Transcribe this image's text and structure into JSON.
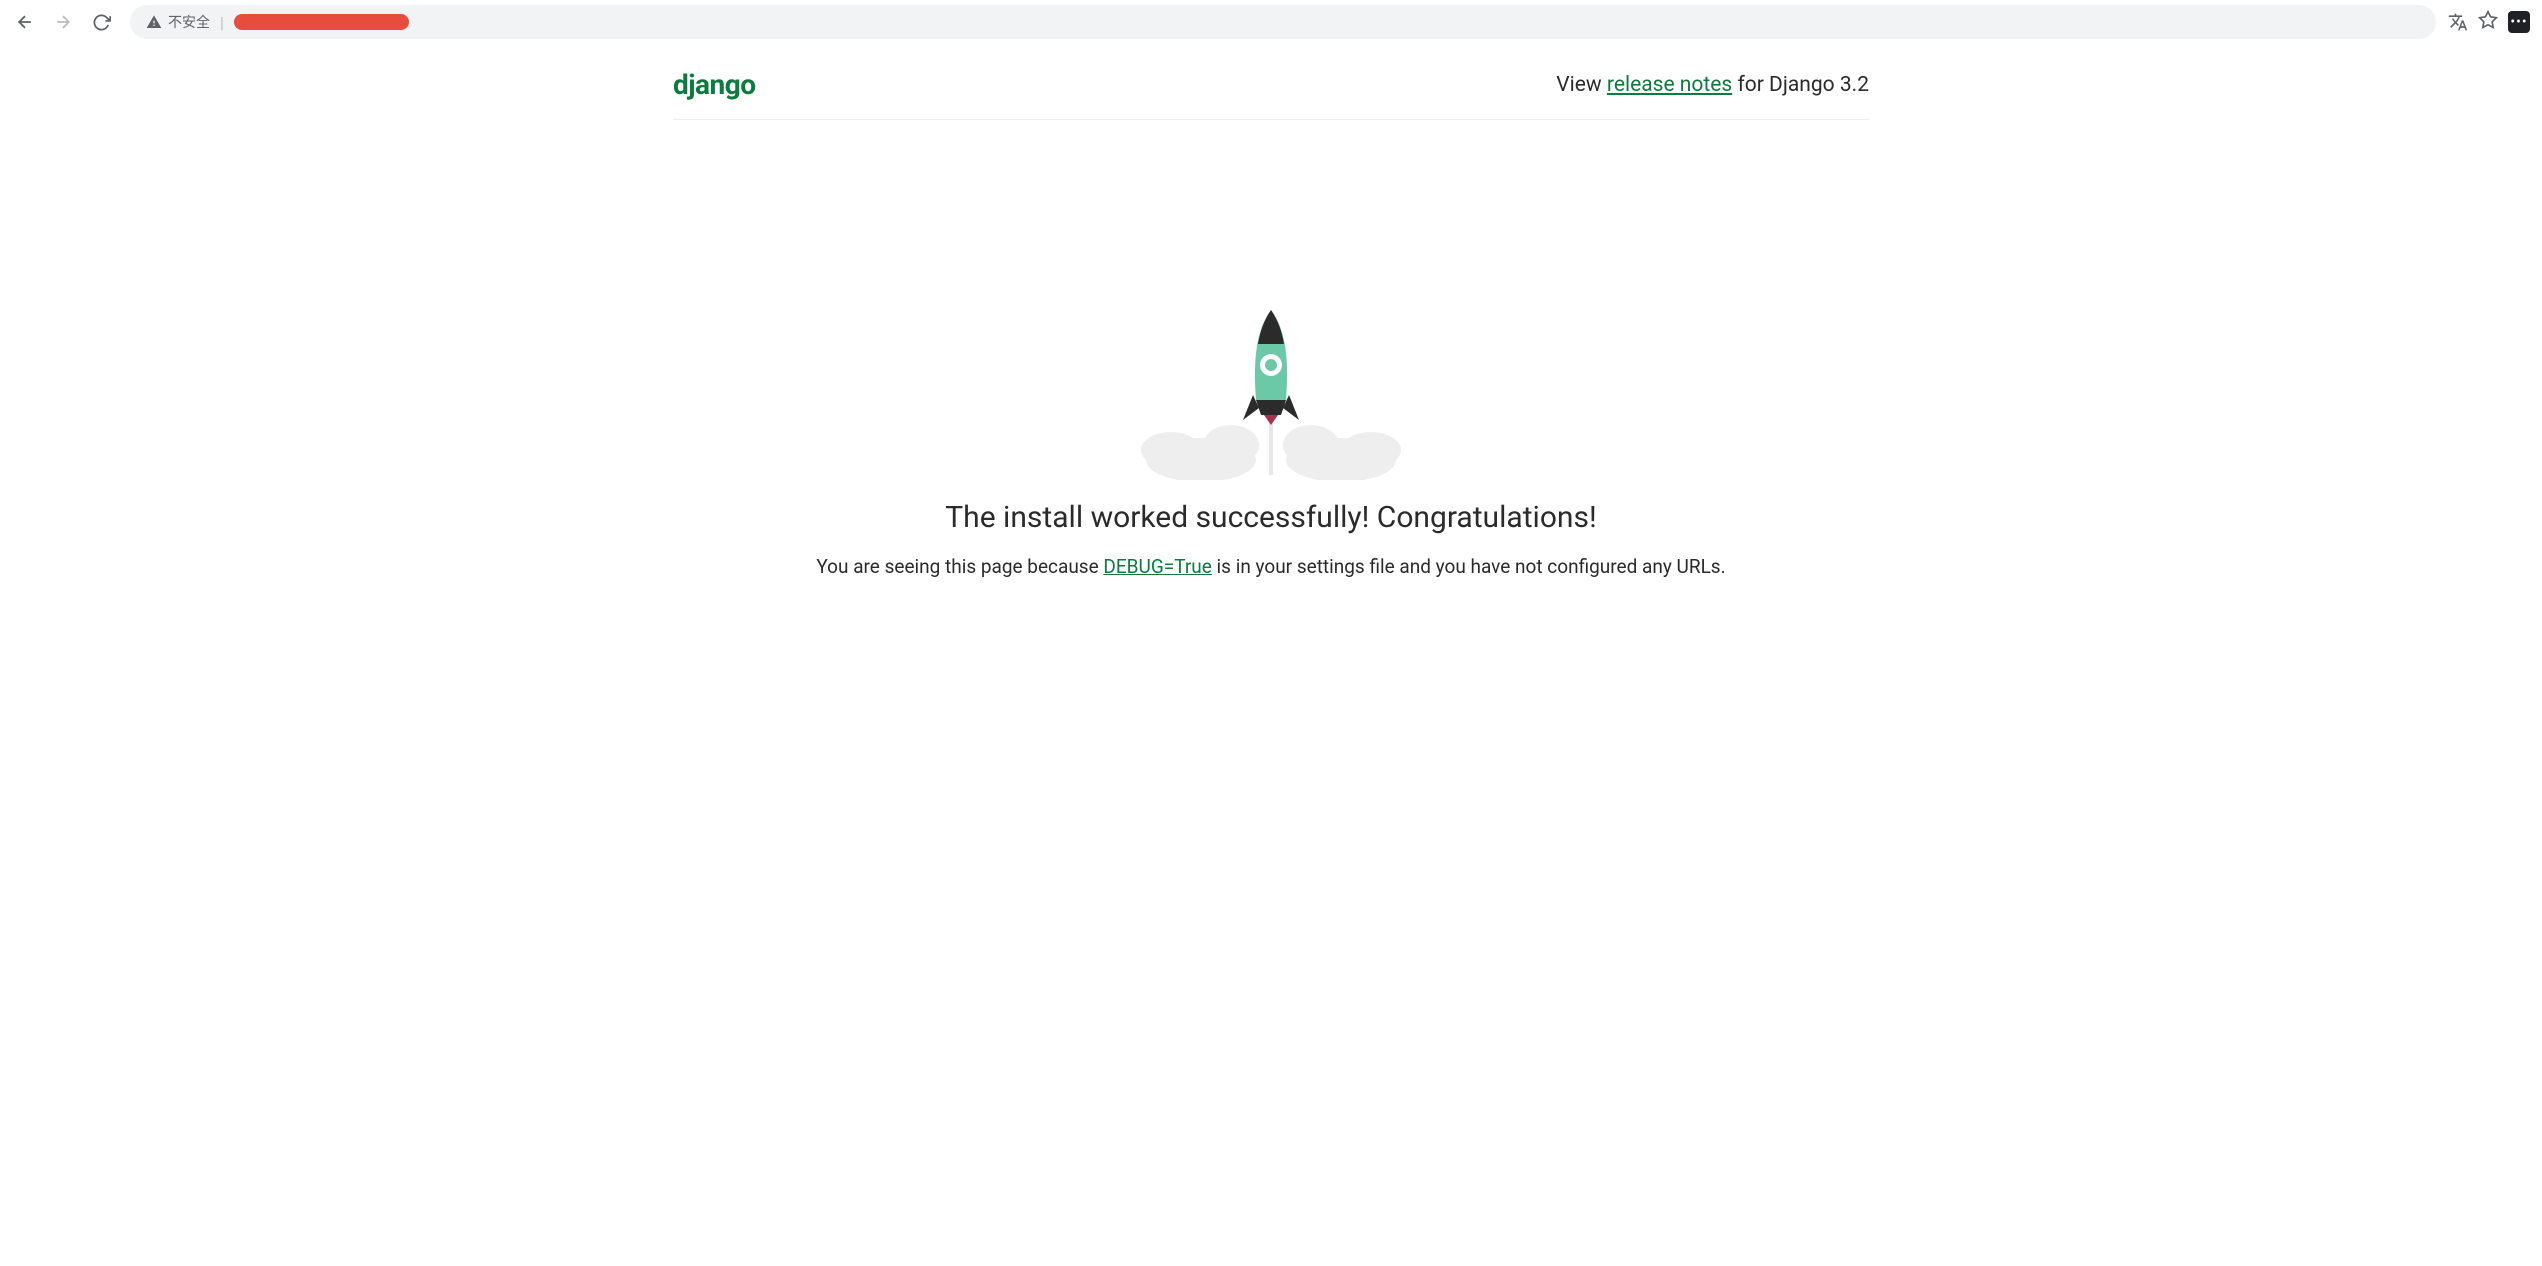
{
  "browser": {
    "security_text": "不安全"
  },
  "header": {
    "logo": "django",
    "view_text": "View ",
    "release_notes_link": "release notes",
    "for_text": " for Django 3.2"
  },
  "main": {
    "headline": "The install worked successfully! Congratulations!",
    "subtext_before": "You are seeing this page because ",
    "debug_link": "DEBUG=True",
    "subtext_after": " is in your settings file and you have not configured any URLs."
  }
}
